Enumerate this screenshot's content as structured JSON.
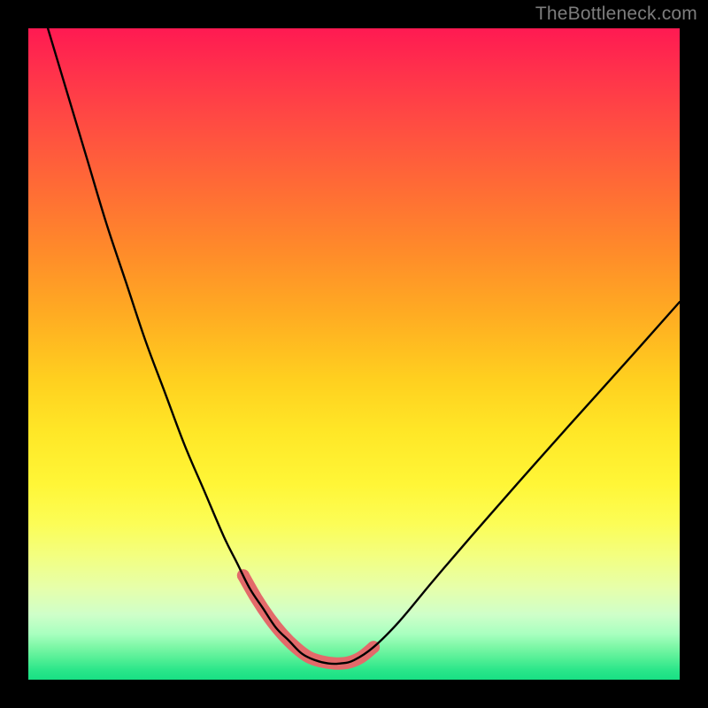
{
  "watermark": "TheBottleneck.com",
  "chart_data": {
    "type": "line",
    "title": "",
    "xlabel": "",
    "ylabel": "",
    "xlim": [
      0,
      100
    ],
    "ylim": [
      0,
      100
    ],
    "grid": false,
    "gradient_stops": [
      {
        "pct": 0,
        "color": "#ff1a52"
      },
      {
        "pct": 6,
        "color": "#ff2f4c"
      },
      {
        "pct": 14,
        "color": "#ff4a43"
      },
      {
        "pct": 24,
        "color": "#ff6a36"
      },
      {
        "pct": 34,
        "color": "#ff8a2a"
      },
      {
        "pct": 44,
        "color": "#ffac22"
      },
      {
        "pct": 54,
        "color": "#ffd01f"
      },
      {
        "pct": 62,
        "color": "#ffe727"
      },
      {
        "pct": 70,
        "color": "#fff637"
      },
      {
        "pct": 76,
        "color": "#fcfd56"
      },
      {
        "pct": 81,
        "color": "#f3ff80"
      },
      {
        "pct": 86,
        "color": "#e6ffab"
      },
      {
        "pct": 90,
        "color": "#cfffc9"
      },
      {
        "pct": 93,
        "color": "#a8ffbf"
      },
      {
        "pct": 95,
        "color": "#7cf7a6"
      },
      {
        "pct": 97,
        "color": "#4eee94"
      },
      {
        "pct": 98.5,
        "color": "#2be68a"
      },
      {
        "pct": 100,
        "color": "#18e084"
      }
    ],
    "series": [
      {
        "name": "bottleneck-curve",
        "color": "#000000",
        "x": [
          3,
          6,
          9,
          12,
          15,
          18,
          21,
          24,
          27,
          30,
          32,
          34,
          36,
          38,
          40,
          42,
          44,
          46,
          48,
          50,
          53,
          57,
          62,
          68,
          75,
          83,
          92,
          100
        ],
        "y": [
          100,
          90,
          80,
          70,
          61,
          52,
          44,
          36,
          29,
          22,
          18,
          14,
          11,
          8,
          6,
          4,
          3,
          2.5,
          2.5,
          3,
          5,
          9,
          15,
          22,
          30,
          39,
          49,
          58
        ]
      },
      {
        "name": "bottom-highlight",
        "color": "#e36a6a",
        "x": [
          33,
          35,
          37,
          39,
          41,
          43,
          45,
          47,
          49,
          51,
          53
        ],
        "y": [
          16,
          12.5,
          9.5,
          7,
          5,
          3.5,
          2.8,
          2.5,
          2.6,
          3.4,
          5
        ]
      }
    ]
  }
}
